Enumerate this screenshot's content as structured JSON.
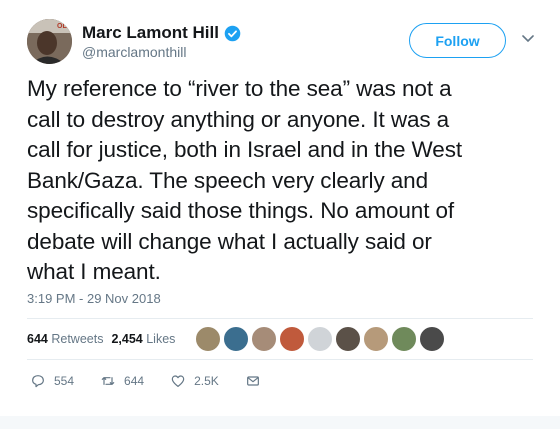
{
  "author": {
    "name": "Marc Lamont Hill",
    "handle": "@marclamonthill",
    "avatar_badge_text": "OL"
  },
  "follow_label": "Follow",
  "tweet": {
    "lines": [
      "My reference to “river to the sea” was not a",
      "call to destroy anything or anyone. It was a",
      "call for justice, both in Israel and in the West",
      "Bank/Gaza. The speech very clearly and",
      "specifically said those things. No amount of",
      "debate will change what I actually said or",
      "what I meant."
    ],
    "timestamp": "3:19 PM - 29 Nov 2018"
  },
  "stats": {
    "retweets_count": "644",
    "retweets_label": "Retweets",
    "likes_count": "2,454",
    "likes_label": "Likes"
  },
  "actions": {
    "reply_count": "554",
    "retweet_count": "644",
    "like_count": "2.5K"
  },
  "colors": {
    "accent": "#1da1f2",
    "secondary_text": "#657786",
    "liker_avatars": [
      "#9c8a6a",
      "#3b6e8f",
      "#a68c78",
      "#c05a3c",
      "#d0d4d8",
      "#5b5148",
      "#b69a7a",
      "#6f8a5b",
      "#4a4a4a"
    ]
  },
  "icons": {
    "verified": "verified-badge-icon",
    "chevron": "chevron-down-icon",
    "reply": "reply-icon",
    "retweet": "retweet-icon",
    "like": "heart-icon",
    "message": "direct-message-icon"
  }
}
